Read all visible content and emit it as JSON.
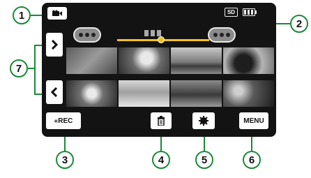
{
  "status_bar": {
    "storage": "SD",
    "mode_icon": "video-camera-icon",
    "battery_icon": "battery-icon"
  },
  "timeline": {
    "date_placeholder": "",
    "prev_date_icon": "pill-dots",
    "next_date_icon": "pill-dots"
  },
  "thumbnails": [
    {
      "name": "thumb-palms"
    },
    {
      "name": "thumb-person"
    },
    {
      "name": "thumb-sunset"
    },
    {
      "name": "thumb-palm-silhouette"
    },
    {
      "name": "thumb-flowers"
    },
    {
      "name": "thumb-beach-chair"
    },
    {
      "name": "thumb-beach-walk"
    },
    {
      "name": "thumb-couple"
    }
  ],
  "buttons": {
    "rec_label": "«REC",
    "menu_label": "MENU"
  },
  "callouts": [
    "1",
    "2",
    "3",
    "4",
    "5",
    "6",
    "7"
  ],
  "colors": {
    "screen_bg": "#131313",
    "accent": "#f2c21b",
    "callout_border": "#1a8a3a"
  }
}
